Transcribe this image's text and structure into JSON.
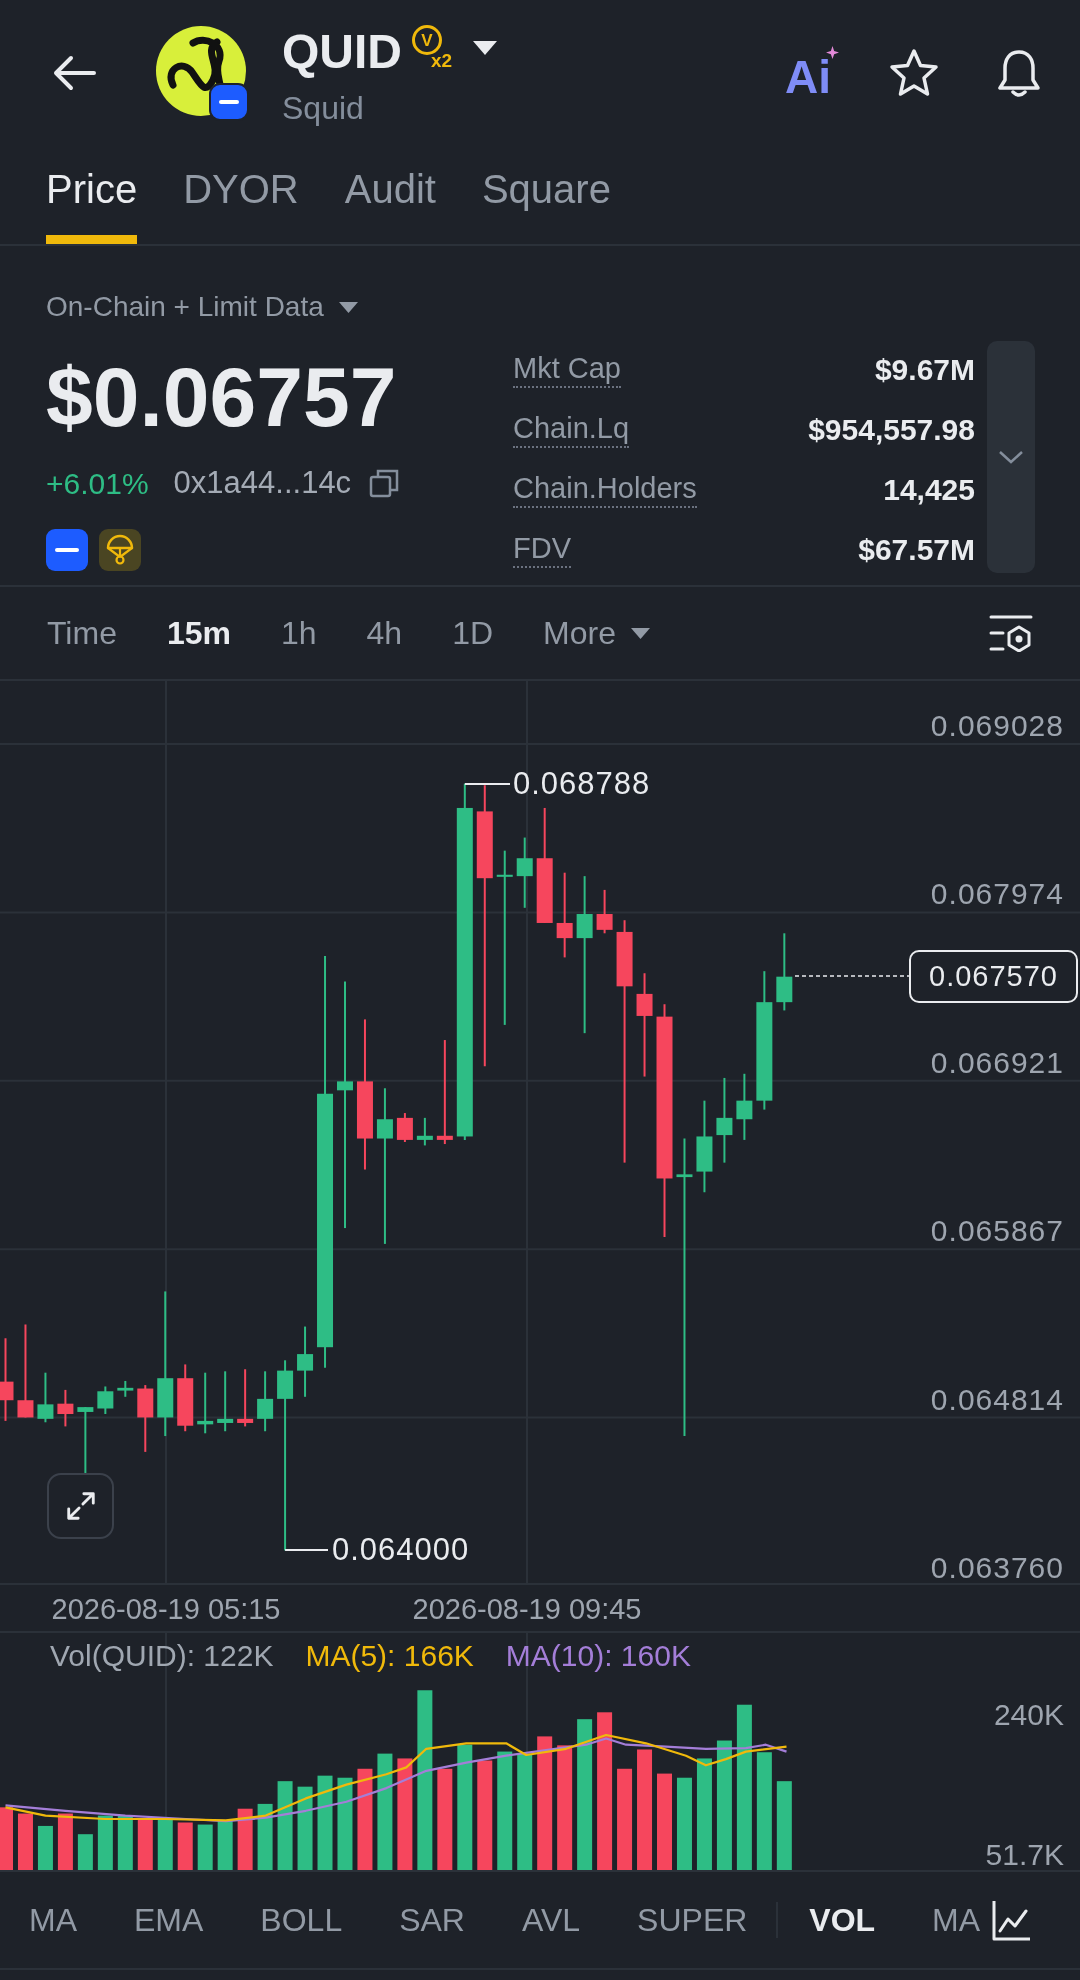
{
  "header": {
    "title": "QUID",
    "badge": {
      "letter": "V",
      "multiplier": "x2"
    },
    "subtitle": "Squid",
    "ai_label": "Ai"
  },
  "tabs": [
    {
      "label": "Price",
      "selected": true
    },
    {
      "label": "DYOR",
      "selected": false
    },
    {
      "label": "Audit",
      "selected": false
    },
    {
      "label": "Square",
      "selected": false
    }
  ],
  "data_source": {
    "label": "On-Chain + Limit Data"
  },
  "price": {
    "value": "$0.06757",
    "change": "+6.01%",
    "rising": true,
    "address": "0x1a44...14c"
  },
  "stats": [
    {
      "label": "Mkt Cap",
      "value": "$9.67M"
    },
    {
      "label": "Chain.Lq",
      "value": "$954,557.98"
    },
    {
      "label": "Chain.Holders",
      "value": "14,425"
    },
    {
      "label": "FDV",
      "value": "$67.57M"
    }
  ],
  "timeframes": [
    {
      "label": "Time",
      "selected": false,
      "kind": "option"
    },
    {
      "label": "15m",
      "selected": true,
      "kind": "option"
    },
    {
      "label": "1h",
      "selected": false,
      "kind": "option"
    },
    {
      "label": "4h",
      "selected": false,
      "kind": "option"
    },
    {
      "label": "1D",
      "selected": false,
      "kind": "option"
    },
    {
      "label": "More",
      "selected": false,
      "kind": "dropdown"
    }
  ],
  "chart": {
    "price_ticks": [
      "0.069028",
      "0.067974",
      "0.066921",
      "0.065867",
      "0.064814",
      "0.063760"
    ],
    "high_label": "0.068788",
    "low_label": "0.064000",
    "last_price": "0.067570",
    "time_labels": [
      "2026-08-19 05:15",
      "2026-08-19 09:45"
    ]
  },
  "volume": {
    "legend": [
      {
        "text": "Vol(QUID): 122K",
        "color": "#a0a7b1"
      },
      {
        "text": "MA(5): 166K",
        "color": "#f0b90b"
      },
      {
        "text": "MA(10): 160K",
        "color": "#a47ed8"
      }
    ],
    "ticks": [
      "240K",
      "51.7K"
    ]
  },
  "indicators": {
    "main": [
      {
        "label": "MA",
        "selected": false
      },
      {
        "label": "EMA",
        "selected": false
      },
      {
        "label": "BOLL",
        "selected": false
      },
      {
        "label": "SAR",
        "selected": false
      },
      {
        "label": "AVL",
        "selected": false
      },
      {
        "label": "SUPER",
        "selected": false
      }
    ],
    "sub": [
      {
        "label": "VOL",
        "selected": true
      },
      {
        "label": "MA",
        "selected": false
      }
    ]
  }
}
